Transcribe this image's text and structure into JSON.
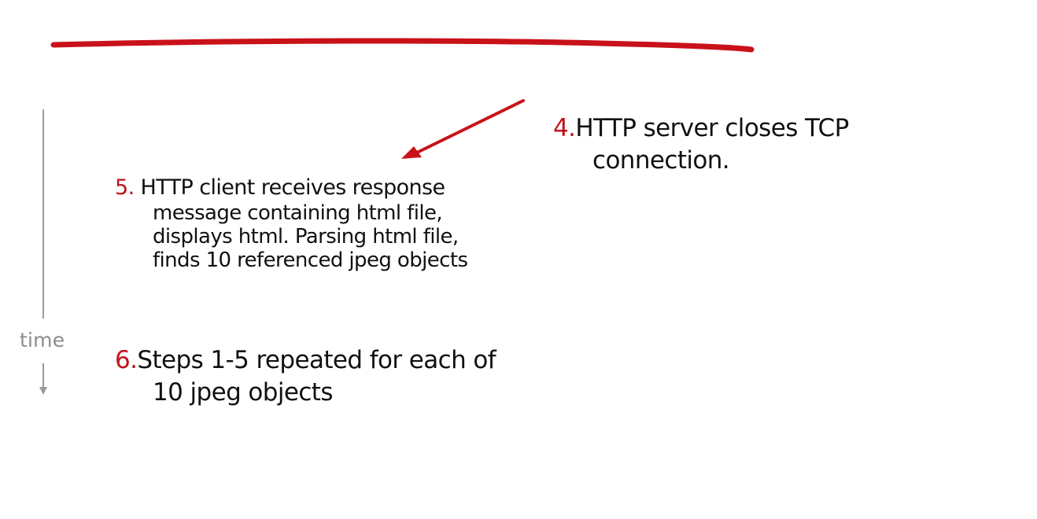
{
  "colors": {
    "accent_red": "#c0141c",
    "arrow_red": "#c9111a",
    "text": "#111111",
    "timeline_gray": "#9a9a9a"
  },
  "timeline": {
    "label": "time"
  },
  "steps": [
    {
      "number": "4.",
      "lines": [
        "HTTP server closes TCP",
        "connection."
      ]
    },
    {
      "number": "5.",
      "lines": [
        "HTTP client receives response",
        "message containing html file,",
        "displays html.  Parsing html file,",
        "finds 10 referenced jpeg  objects"
      ]
    },
    {
      "number": "6.",
      "lines": [
        "Steps 1-5 repeated for each of",
        "10 jpeg objects"
      ]
    }
  ]
}
